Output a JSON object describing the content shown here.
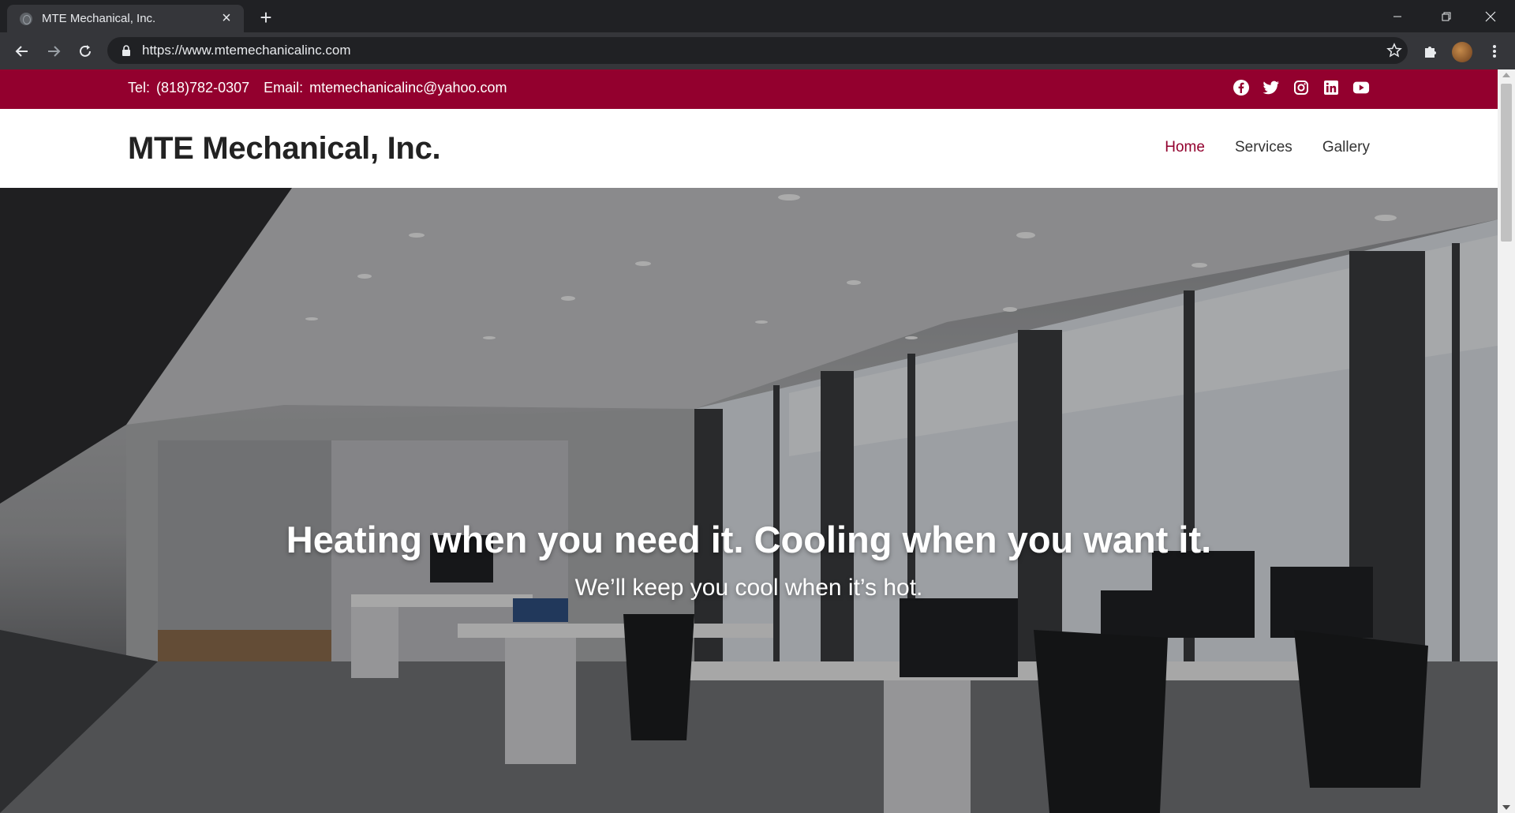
{
  "browser": {
    "tab_title": "MTE Mechanical, Inc.",
    "url": "https://www.mtemechanicalinc.com"
  },
  "topbar": {
    "tel_label": "Tel:",
    "tel_value": "(818)782-0307",
    "email_label": "Email:",
    "email_value": "mtemechanicalinc@yahoo.com",
    "social_icons": [
      "facebook-icon",
      "twitter-icon",
      "instagram-icon",
      "linkedin-icon",
      "youtube-icon"
    ]
  },
  "header": {
    "brand": "MTE Mechanical, Inc.",
    "nav": [
      {
        "label": "Home",
        "active": true
      },
      {
        "label": "Services",
        "active": false
      },
      {
        "label": "Gallery",
        "active": false
      }
    ]
  },
  "hero": {
    "title": "Heating when you need it. Cooling when you want it.",
    "subtitle": "We’ll keep you cool when it’s hot."
  },
  "colors": {
    "brand_accent": "#93002e",
    "chrome_dark": "#202124",
    "chrome_toolbar": "#35363a"
  }
}
